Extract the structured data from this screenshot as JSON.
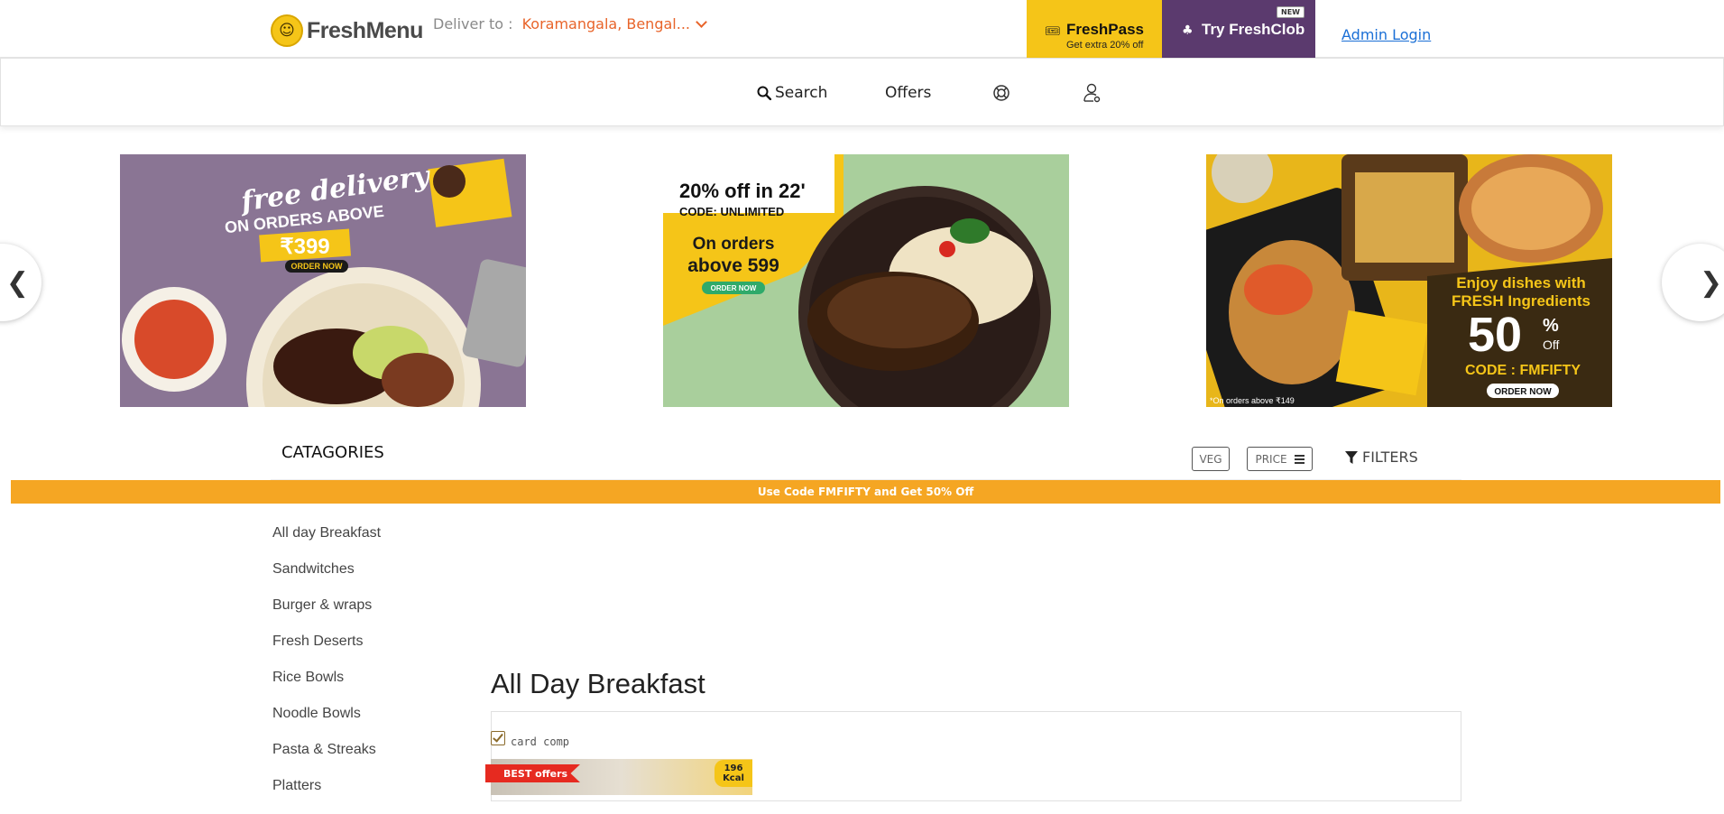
{
  "header": {
    "brand": "FreshMenu",
    "deliver_label": "Deliver to :",
    "deliver_location": "Koramangala, Bengal...",
    "freshpass": {
      "title": "FreshPass",
      "subtitle": "Get extra 20% off"
    },
    "freshclob": {
      "title": "Try FreshClob",
      "badge": "NEW"
    },
    "admin_login": "Admin Login"
  },
  "nav": {
    "search": "Search",
    "offers": "Offers"
  },
  "banners": [
    {
      "line1": "free delivery",
      "line2": "ON ORDERS ABOVE",
      "amount": "₹399",
      "cta": "ORDER NOW"
    },
    {
      "headline_a": "20% off in 22'",
      "code": "CODE: UNLIMITED",
      "line1": "On orders",
      "line2": "above 599",
      "cta": "ORDER NOW"
    },
    {
      "line1": "Enjoy dishes with",
      "line2": "FRESH Ingredients",
      "percent": "50",
      "pct_sign": "%",
      "off": "Off",
      "code": "CODE : FMFIFTY",
      "cta": "ORDER NOW",
      "note": "*On orders above ₹149"
    }
  ],
  "carousel": {
    "prev": "❮",
    "next": "❯"
  },
  "categories_header": "CATAGORIES",
  "filters": {
    "veg": "VEG",
    "price": "PRICE",
    "filters": "FILTERS"
  },
  "promo_strip": "Use Code FMFIFTY and Get 50% Off",
  "sidebar": {
    "items": [
      {
        "label": "All day Breakfast"
      },
      {
        "label": "Sandwitches"
      },
      {
        "label": "Burger & wraps"
      },
      {
        "label": "Fresh Deserts"
      },
      {
        "label": "Rice Bowls"
      },
      {
        "label": "Noodle Bowls"
      },
      {
        "label": "Pasta & Streaks"
      },
      {
        "label": "Platters"
      }
    ]
  },
  "main": {
    "section_title": "All Day Breakfast",
    "card_comp": "card comp",
    "best_badge": "BEST offers",
    "kcal_value": "196",
    "kcal_unit": "Kcal"
  },
  "colors": {
    "brand_yellow": "#f5c518",
    "clob_purple": "#5b3a6e",
    "accent_orange": "#e8642a",
    "promo_orange": "#f5a623",
    "link_blue": "#1a6fd6"
  }
}
